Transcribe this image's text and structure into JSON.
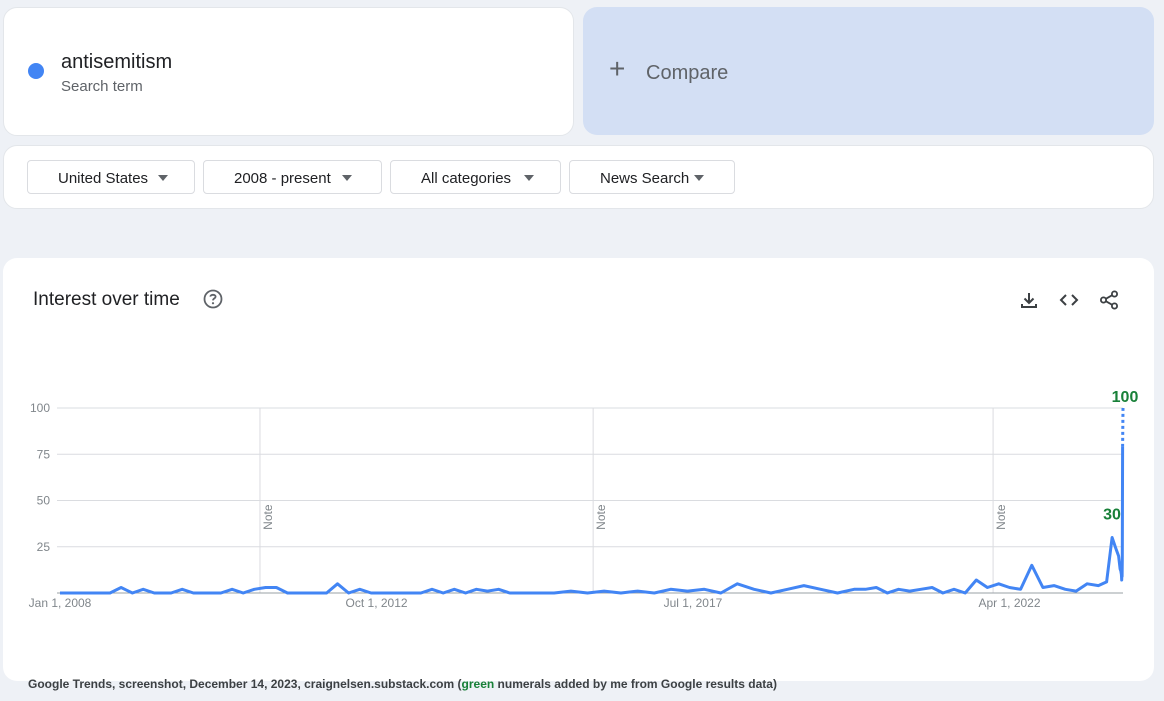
{
  "term": {
    "name": "antisemitism",
    "subtitle": "Search term",
    "color": "#4285f4"
  },
  "compare": {
    "label": "Compare",
    "icon": "plus-icon"
  },
  "filters": {
    "region": "United States",
    "time": "2008 - present",
    "category": "All categories",
    "property": "News Search"
  },
  "chart_header": {
    "title": "Interest over time",
    "help_icon": "help-circle-icon",
    "tools": [
      "download-icon",
      "embed-code-icon",
      "share-icon"
    ]
  },
  "chart_data": {
    "type": "line",
    "title": "Interest over time",
    "xlabel": "",
    "ylabel": "",
    "ylim": [
      0,
      100
    ],
    "y_ticks": [
      100,
      75,
      50,
      25
    ],
    "x_range": [
      "2008-01-01",
      "2023-12-14"
    ],
    "x_ticks": [
      {
        "date": "2008-01-01",
        "label": "Jan 1, 2008"
      },
      {
        "date": "2012-10-01",
        "label": "Oct 1, 2012"
      },
      {
        "date": "2017-07-01",
        "label": "Jul 1, 2017"
      },
      {
        "date": "2022-04-01",
        "label": "Apr 1, 2022"
      }
    ],
    "notes": [
      {
        "date": "2011-01-01",
        "label": "Note"
      },
      {
        "date": "2016-01-01",
        "label": "Note"
      },
      {
        "date": "2022-01-01",
        "label": "Note"
      }
    ],
    "grid": true,
    "series": [
      {
        "color": "#4285f4",
        "points": [
          [
            "2008-01-01",
            0
          ],
          [
            "2008-10-01",
            0
          ],
          [
            "2008-12-01",
            3
          ],
          [
            "2009-02-01",
            0
          ],
          [
            "2009-04-01",
            2
          ],
          [
            "2009-06-01",
            0
          ],
          [
            "2009-09-01",
            0
          ],
          [
            "2009-11-01",
            2
          ],
          [
            "2010-01-01",
            0
          ],
          [
            "2010-06-01",
            0
          ],
          [
            "2010-08-01",
            2
          ],
          [
            "2010-10-01",
            0
          ],
          [
            "2010-12-01",
            2
          ],
          [
            "2011-02-01",
            3
          ],
          [
            "2011-04-01",
            3
          ],
          [
            "2011-06-01",
            0
          ],
          [
            "2012-01-01",
            0
          ],
          [
            "2012-03-01",
            5
          ],
          [
            "2012-05-01",
            0
          ],
          [
            "2012-07-01",
            2
          ],
          [
            "2012-09-01",
            0
          ],
          [
            "2013-06-01",
            0
          ],
          [
            "2013-08-01",
            2
          ],
          [
            "2013-10-01",
            0
          ],
          [
            "2013-12-01",
            2
          ],
          [
            "2014-02-01",
            0
          ],
          [
            "2014-04-01",
            2
          ],
          [
            "2014-06-01",
            1
          ],
          [
            "2014-08-01",
            2
          ],
          [
            "2014-10-01",
            0
          ],
          [
            "2015-06-01",
            0
          ],
          [
            "2015-09-01",
            1
          ],
          [
            "2015-12-01",
            0
          ],
          [
            "2016-03-01",
            1
          ],
          [
            "2016-06-01",
            0
          ],
          [
            "2016-09-01",
            1
          ],
          [
            "2016-12-01",
            0
          ],
          [
            "2017-03-01",
            2
          ],
          [
            "2017-06-01",
            1
          ],
          [
            "2017-09-01",
            2
          ],
          [
            "2017-12-01",
            0
          ],
          [
            "2018-03-01",
            5
          ],
          [
            "2018-06-01",
            2
          ],
          [
            "2018-09-01",
            0
          ],
          [
            "2018-12-01",
            2
          ],
          [
            "2019-03-01",
            4
          ],
          [
            "2019-06-01",
            2
          ],
          [
            "2019-09-01",
            0
          ],
          [
            "2019-12-01",
            2
          ],
          [
            "2020-02-01",
            2
          ],
          [
            "2020-04-01",
            3
          ],
          [
            "2020-06-01",
            0
          ],
          [
            "2020-08-01",
            2
          ],
          [
            "2020-10-01",
            1
          ],
          [
            "2020-12-01",
            2
          ],
          [
            "2021-02-01",
            3
          ],
          [
            "2021-04-01",
            0
          ],
          [
            "2021-06-01",
            2
          ],
          [
            "2021-08-01",
            0
          ],
          [
            "2021-10-01",
            7
          ],
          [
            "2021-12-01",
            3
          ],
          [
            "2022-02-01",
            5
          ],
          [
            "2022-04-01",
            3
          ],
          [
            "2022-06-01",
            2
          ],
          [
            "2022-08-01",
            15
          ],
          [
            "2022-10-01",
            3
          ],
          [
            "2022-12-01",
            4
          ],
          [
            "2023-02-01",
            2
          ],
          [
            "2023-04-01",
            1
          ],
          [
            "2023-06-01",
            5
          ],
          [
            "2023-08-01",
            4
          ],
          [
            "2023-09-15",
            6
          ],
          [
            "2023-10-15",
            30
          ],
          [
            "2023-11-05",
            24
          ],
          [
            "2023-11-20",
            20
          ],
          [
            "2023-11-28",
            13
          ],
          [
            "2023-12-02",
            12
          ],
          [
            "2023-12-05",
            10
          ],
          [
            "2023-12-07",
            7
          ],
          [
            "2023-12-08",
            11
          ],
          [
            "2023-12-09",
            9
          ],
          [
            "2023-12-10",
            18
          ],
          [
            "2023-12-11",
            60
          ],
          [
            "2023-12-12",
            79
          ]
        ],
        "partial": [
          [
            "2023-12-12",
            79
          ],
          [
            "2023-12-14",
            100
          ]
        ]
      }
    ],
    "annotations": [
      {
        "date": "2023-10-15",
        "value": 30,
        "text": "30",
        "color": "#188038"
      },
      {
        "date": "2023-12-14",
        "value": 100,
        "text": "100",
        "color": "#188038"
      }
    ]
  },
  "footer": {
    "text_before": "Google Trends, screenshot, December 14, 2023, craignelsen.substack.com  (",
    "green_word": "green",
    "text_after": " numerals added by me from Google results data)"
  }
}
